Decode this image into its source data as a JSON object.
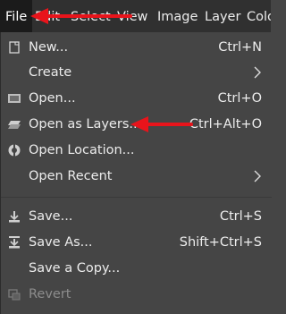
{
  "menubar": {
    "items": [
      {
        "label": "File"
      },
      {
        "label": "Edit"
      },
      {
        "label": "Select"
      },
      {
        "label": "View"
      },
      {
        "label": "Image"
      },
      {
        "label": "Layer"
      },
      {
        "label": "Colo"
      }
    ]
  },
  "file_menu": {
    "items": [
      {
        "label": "New...",
        "shortcut": "Ctrl+N",
        "icon": "new-image-icon"
      },
      {
        "label": "Create",
        "submenu": true
      },
      {
        "label": "Open...",
        "shortcut": "Ctrl+O",
        "icon": "open-image-icon"
      },
      {
        "label": "Open as Layers...",
        "shortcut": "Ctrl+Alt+O",
        "icon": "open-as-layers-icon"
      },
      {
        "label": "Open Location...",
        "icon": "web-location-icon"
      },
      {
        "label": "Open Recent",
        "submenu": true
      },
      {
        "label": "Save...",
        "shortcut": "Ctrl+S",
        "icon": "save-icon"
      },
      {
        "label": "Save As...",
        "shortcut": "Shift+Ctrl+S",
        "icon": "save-as-icon"
      },
      {
        "label": "Save a Copy..."
      },
      {
        "label": "Revert",
        "icon": "revert-icon",
        "disabled": true
      }
    ]
  },
  "annotation_color": "#e8141b"
}
